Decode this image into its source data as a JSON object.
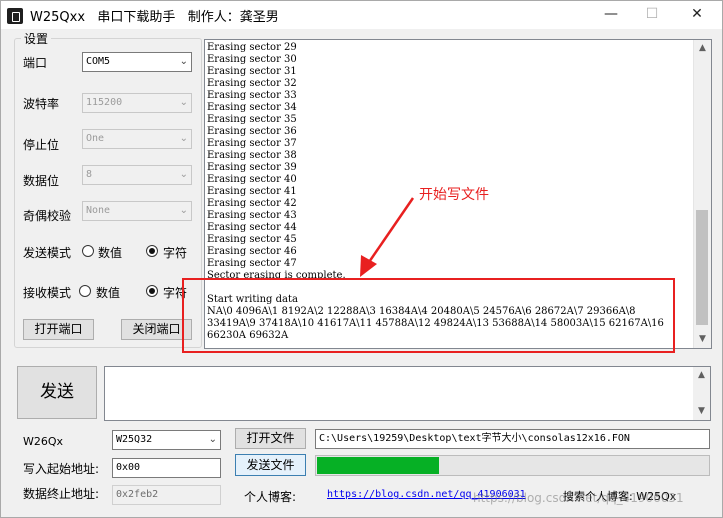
{
  "window": {
    "title": "W25Qxx   串口下载助手   制作人：龚圣男",
    "controls": {
      "minimize": "—",
      "maximize": "☐",
      "close": "✕"
    }
  },
  "settings": {
    "group_title": "设置",
    "port": {
      "label": "端口",
      "value": "COM5"
    },
    "baud": {
      "label": "波特率",
      "value": "115200"
    },
    "stopbits": {
      "label": "停止位",
      "value": "One"
    },
    "databits": {
      "label": "数据位",
      "value": "8"
    },
    "parity": {
      "label": "奇偶校验",
      "value": "None"
    },
    "send_mode": {
      "label": "发送模式",
      "opt_value": "数值",
      "opt_char": "字符",
      "selected": "字符"
    },
    "recv_mode": {
      "label": "接收模式",
      "opt_value": "数值",
      "opt_char": "字符",
      "selected": "字符"
    },
    "open_port": "打开端口",
    "close_port": "关闭端口"
  },
  "output": {
    "text": "Erasing sector 29\nErasing sector 30\nErasing sector 31\nErasing sector 32\nErasing sector 33\nErasing sector 34\nErasing sector 35\nErasing sector 36\nErasing sector 37\nErasing sector 38\nErasing sector 39\nErasing sector 40\nErasing sector 41\nErasing sector 42\nErasing sector 43\nErasing sector 44\nErasing sector 45\nErasing sector 46\nErasing sector 47\nSector erasing is complete.\n\nStart writing data\nNA\\0 4096A\\1 8192A\\2 12288A\\3 16384A\\4 20480A\\5 24576A\\6 28672A\\7 29366A\\8\n33419A\\9 37418A\\10 41617A\\11 45788A\\12 49824A\\13 53688A\\14 58003A\\15 62167A\\16\n66230A 69632A",
    "annotation": "开始写文件"
  },
  "send": {
    "button": "发送",
    "content": ""
  },
  "bottom": {
    "chip_label": "W26Qx",
    "chip_value": "W25Q32",
    "open_file": "打开文件",
    "file_path": "C:\\Users\\19259\\Desktop\\text字节大小\\consolas12x16.FON",
    "start_addr_label": "写入起始地址:",
    "start_addr_value": "0x00",
    "send_file": "发送文件",
    "progress_fraction": 0.31,
    "end_addr_label": "数据终止地址:",
    "end_addr_value": "0x2feb2",
    "blog_label": "个人博客:",
    "blog_url": "https://blog.csdn.net/qq_41906031",
    "search_text": "搜索个人博客: W25Qx",
    "watermark": "https://blog.csdn.net/qq_41906031"
  },
  "colors": {
    "annotation": "#e82020",
    "progress": "#06b025",
    "link": "#0000ee"
  }
}
